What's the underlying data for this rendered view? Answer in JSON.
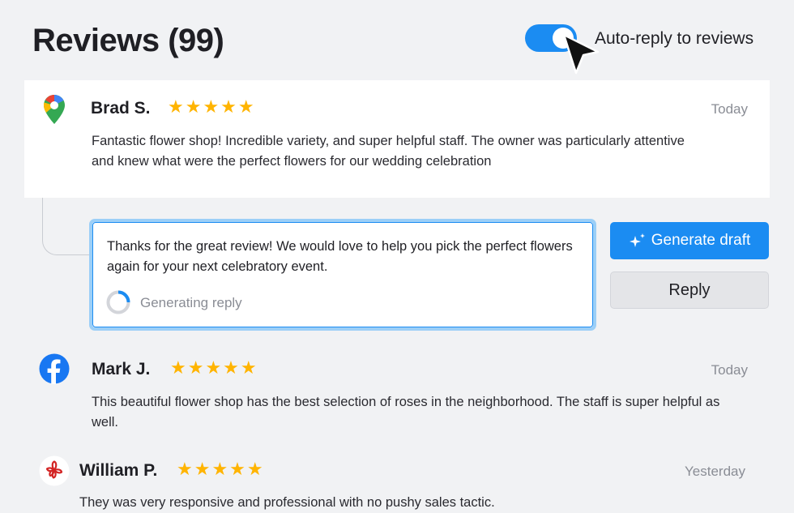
{
  "header": {
    "title": "Reviews (99)",
    "auto_reply_label": "Auto-reply to reviews",
    "auto_reply_on": true
  },
  "reviews": [
    {
      "source_icon": "google-maps-icon",
      "name": "Brad S.",
      "stars": "★★★★★",
      "rating": 5,
      "date": "Today",
      "text": "Fantastic flower shop! Incredible variety, and super helpful staff.  The owner was particularly attentive and knew what were the  perfect flowers for our wedding celebration"
    },
    {
      "source_icon": "facebook-icon",
      "name": "Mark J.",
      "stars": "★★★★★",
      "rating": 5,
      "date": "Today",
      "text": "This beautiful flower shop has the best selection of roses in the neighborhood. The staff is super helpful as well."
    },
    {
      "source_icon": "yelp-icon",
      "name": "William P.",
      "stars": "★★★★★",
      "rating": 5,
      "date": "Yesterday",
      "text": "They was very responsive and professional with no pushy sales tactic."
    }
  ],
  "reply": {
    "text": "Thanks for the great review! We would love to help you pick the perfect flowers again for your next celebratory event.",
    "status": "Generating reply"
  },
  "actions": {
    "generate_label": "Generate draft",
    "reply_label": "Reply"
  },
  "colors": {
    "accent": "#1b8cf2",
    "star": "#ffb400",
    "background": "#f1f2f4"
  }
}
